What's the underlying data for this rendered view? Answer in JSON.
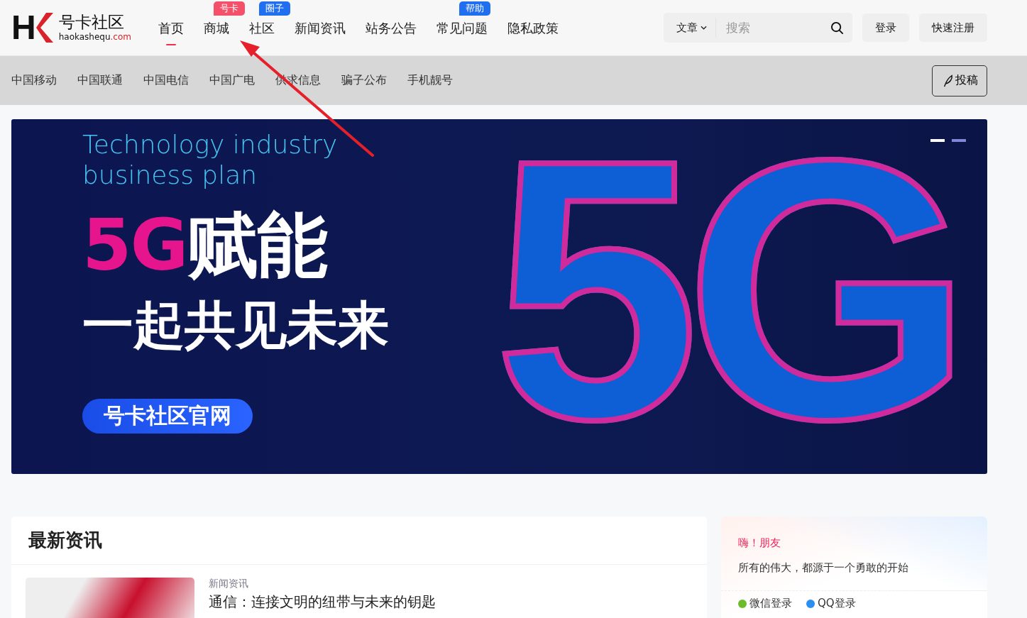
{
  "logo": {
    "mark": "H",
    "brand": "号卡社区",
    "domain_main": "haokashequ",
    "domain_tld": ".com"
  },
  "nav": [
    {
      "label": "首页",
      "selected": true
    },
    {
      "label": "商城",
      "selected": false,
      "badge": {
        "text": "号卡",
        "color": "#f4506a"
      }
    },
    {
      "label": "社区",
      "selected": false,
      "badge": {
        "text": "圈子",
        "color": "#1f6ff0"
      }
    },
    {
      "label": "新闻资讯",
      "selected": false
    },
    {
      "label": "站务公告",
      "selected": false
    },
    {
      "label": "常见问题",
      "selected": false,
      "badge": {
        "text": "帮助",
        "color": "#1f6ff0"
      }
    },
    {
      "label": "隐私政策",
      "selected": false
    }
  ],
  "search": {
    "scope": "文章",
    "placeholder": "搜索"
  },
  "account_buttons": [
    "登录",
    "快速注册"
  ],
  "subnav": [
    "中国移动",
    "中国联通",
    "中国电信",
    "中国广电",
    "供求信息",
    "骗子公布",
    "手机靓号"
  ],
  "post_button": "投稿",
  "banner": {
    "eyebrow_line_1": "Technology industry",
    "eyebrow_line_2": "business plan",
    "headline_accent": "5G",
    "headline_rest": "赋能",
    "subheadline": "一起共见未来",
    "cta": "号卡社区官网",
    "art_text": "5G",
    "slides": [
      {
        "selected": true
      },
      {
        "selected": false
      }
    ]
  },
  "news": {
    "title": "最新资讯",
    "items": [
      {
        "category": "新闻资讯",
        "title": "通信：连接文明的纽带与未来的钥匙"
      }
    ]
  },
  "welcome": {
    "greeting": "嗨！朋友",
    "motto": "所有的伟大，都源于一个勇敢的开始",
    "logins": [
      {
        "label": "微信登录",
        "color": "#6cbb2b"
      },
      {
        "label": "QQ登录",
        "color": "#2b8ef0"
      }
    ]
  }
}
